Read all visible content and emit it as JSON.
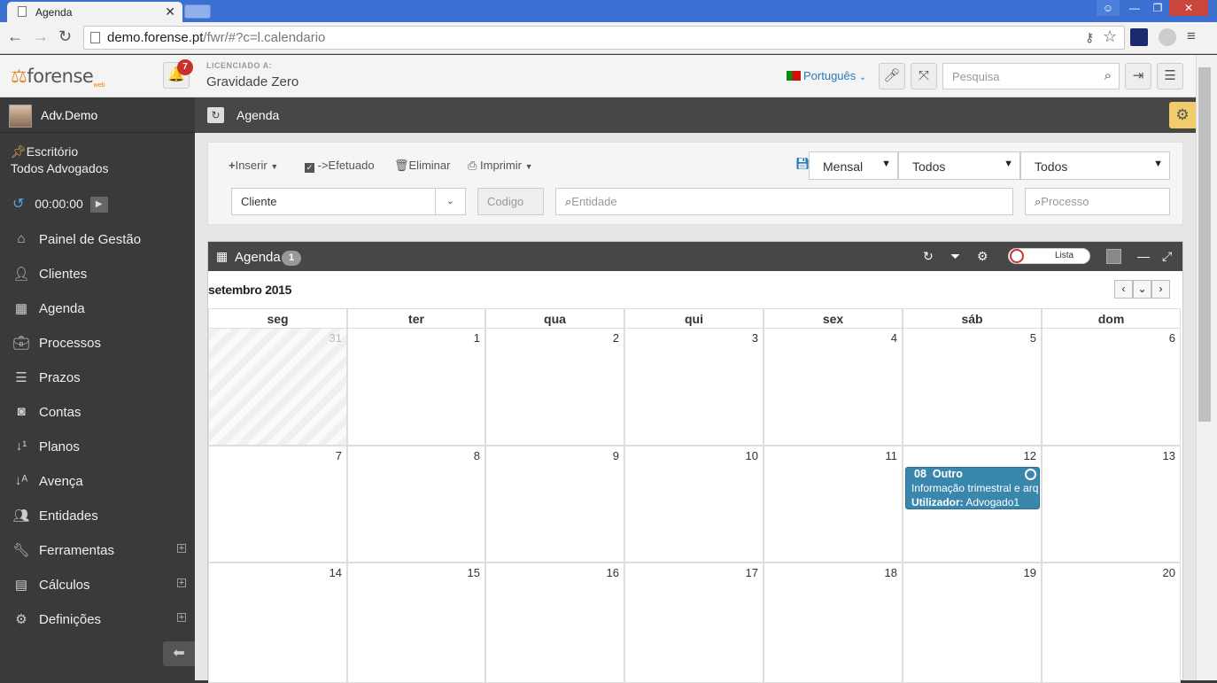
{
  "browser": {
    "tab_title": "Agenda",
    "url_domain": "demo.forense.pt",
    "url_path": "/fwr/#?c=l.calendario"
  },
  "header": {
    "logo": "forense",
    "logo_sub": "web",
    "notifications": "7",
    "licensed_label": "LICENCIADO A:",
    "licensee": "Gravidade Zero",
    "language": "Português",
    "search_placeholder": "Pesquisa"
  },
  "sidebar": {
    "user": "Adv.Demo",
    "office_line1": "Escritório",
    "office_line2": "Todos Advogados",
    "timer": "00:00:00",
    "items": [
      {
        "label": "Painel de Gestão",
        "icon": "home-icon"
      },
      {
        "label": "Clientes",
        "icon": "user-icon"
      },
      {
        "label": "Agenda",
        "icon": "calendar-icon"
      },
      {
        "label": "Processos",
        "icon": "briefcase-icon"
      },
      {
        "label": "Prazos",
        "icon": "server-icon"
      },
      {
        "label": "Contas",
        "icon": "money-icon"
      },
      {
        "label": "Planos",
        "icon": "sort-numeric-icon"
      },
      {
        "label": "Avença",
        "icon": "sort-alpha-icon"
      },
      {
        "label": "Entidades",
        "icon": "users-icon"
      },
      {
        "label": "Ferramentas",
        "icon": "wrench-icon",
        "expand": true
      },
      {
        "label": "Cálculos",
        "icon": "building-icon",
        "expand": true
      },
      {
        "label": "Definições",
        "icon": "cogs-icon",
        "expand": true
      }
    ]
  },
  "content": {
    "title": "Agenda",
    "toolbar": {
      "insert": "Inserir",
      "done": "->Efetuado",
      "delete": "Eliminar",
      "print": "Imprimir",
      "view": "Mensal",
      "filter1": "Todos",
      "filter2": "Todos",
      "client": "Cliente",
      "code_placeholder": "Codigo",
      "entity_placeholder": "Entidade",
      "process_placeholder": "Processo"
    },
    "panel": {
      "title": "Agenda",
      "count": "1",
      "toggle_label": "Lista",
      "month": "setembro 2015",
      "weekdays": [
        "seg",
        "ter",
        "qua",
        "qui",
        "sex",
        "sáb",
        "dom"
      ],
      "weeks": [
        [
          "31",
          "1",
          "2",
          "3",
          "4",
          "5",
          "6"
        ],
        [
          "7",
          "8",
          "9",
          "10",
          "11",
          "12",
          "13"
        ],
        [
          "14",
          "15",
          "16",
          "17",
          "18",
          "19",
          "20"
        ]
      ],
      "event": {
        "time": "08",
        "type": "Outro",
        "description": "Informação trimestral e arquivo",
        "user_label": "Utilizador:",
        "user": "Advogado1",
        "color": "#3a87ad"
      }
    }
  }
}
